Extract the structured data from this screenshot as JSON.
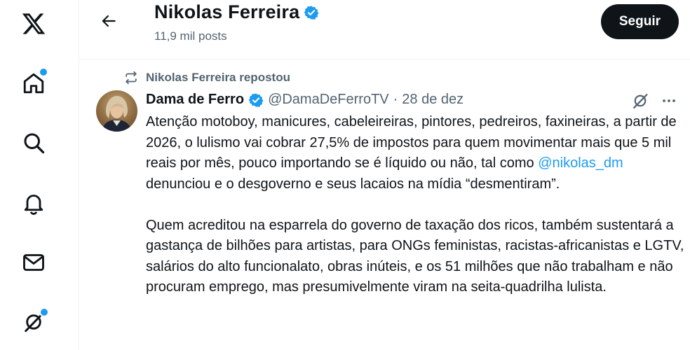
{
  "nav": {
    "items": [
      {
        "icon": "x-logo-icon"
      },
      {
        "icon": "home-icon",
        "notification": true
      },
      {
        "icon": "search-icon"
      },
      {
        "icon": "bell-icon"
      },
      {
        "icon": "mail-icon"
      },
      {
        "icon": "grok-icon",
        "notification": true
      }
    ]
  },
  "header": {
    "name": "Nikolas Ferreira",
    "posts": "11,9 mil posts",
    "follow_label": "Seguir",
    "verified": true
  },
  "tweet": {
    "repost_label": "Nikolas Ferreira repostou",
    "author_name": "Dama de Ferro",
    "handle": "@DamaDeFerroTV",
    "separator": "·",
    "date": "28 de dez",
    "paragraph1_before": "Atenção motoboy, manicures, cabeleireiras, pintores, pedreiros, faxineiras, a partir de 2026, o lulismo vai cobrar 27,5% de impostos  para quem movimentar mais que 5 mil reais por mês, pouco importando se é líquido ou não, tal como ",
    "mention": "@nikolas_dm",
    "paragraph1_after": " denunciou e o desgoverno e seus lacaios na mídia “desmentiram”.",
    "paragraph2": "Quem acreditou na esparrela do governo de taxação dos ricos, também sustentará a gastança de bilhões para artistas, para ONGs feministas, racistas-africanistas e LGTV, salários do alto funcionalato, obras inúteis, e os 51 milhões que não trabalham e não procuram emprego, mas presumivelmente viram na seita-quadrilha lulista."
  },
  "colors": {
    "accent": "#1d9bf0",
    "text": "#0f1419",
    "muted": "#536471",
    "follow_bg": "#0f1419"
  }
}
